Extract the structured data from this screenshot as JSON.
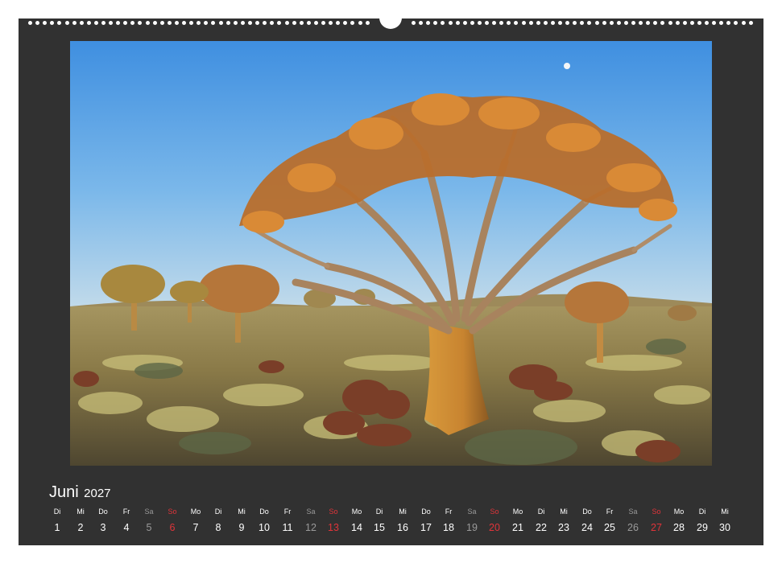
{
  "calendar": {
    "month": "Juni",
    "year": "2027",
    "photo_subject": "quiver-tree-landscape",
    "colors": {
      "frame": "#313131",
      "text": "#ffffff",
      "saturday": "#9a9a9a",
      "sunday": "#e0343a",
      "sky_top": "#3f8fe0",
      "sky_bottom": "#bcd9ee",
      "ground": "#8a7a48"
    },
    "days": [
      {
        "wd": "Di",
        "num": "1",
        "type": "weekday"
      },
      {
        "wd": "Mi",
        "num": "2",
        "type": "weekday"
      },
      {
        "wd": "Do",
        "num": "3",
        "type": "weekday"
      },
      {
        "wd": "Fr",
        "num": "4",
        "type": "weekday"
      },
      {
        "wd": "Sa",
        "num": "5",
        "type": "sat"
      },
      {
        "wd": "So",
        "num": "6",
        "type": "sun"
      },
      {
        "wd": "Mo",
        "num": "7",
        "type": "weekday"
      },
      {
        "wd": "Di",
        "num": "8",
        "type": "weekday"
      },
      {
        "wd": "Mi",
        "num": "9",
        "type": "weekday"
      },
      {
        "wd": "Do",
        "num": "10",
        "type": "weekday"
      },
      {
        "wd": "Fr",
        "num": "11",
        "type": "weekday"
      },
      {
        "wd": "Sa",
        "num": "12",
        "type": "sat"
      },
      {
        "wd": "So",
        "num": "13",
        "type": "sun"
      },
      {
        "wd": "Mo",
        "num": "14",
        "type": "weekday"
      },
      {
        "wd": "Di",
        "num": "15",
        "type": "weekday"
      },
      {
        "wd": "Mi",
        "num": "16",
        "type": "weekday"
      },
      {
        "wd": "Do",
        "num": "17",
        "type": "weekday"
      },
      {
        "wd": "Fr",
        "num": "18",
        "type": "weekday"
      },
      {
        "wd": "Sa",
        "num": "19",
        "type": "sat"
      },
      {
        "wd": "So",
        "num": "20",
        "type": "sun"
      },
      {
        "wd": "Mo",
        "num": "21",
        "type": "weekday"
      },
      {
        "wd": "Di",
        "num": "22",
        "type": "weekday"
      },
      {
        "wd": "Mi",
        "num": "23",
        "type": "weekday"
      },
      {
        "wd": "Do",
        "num": "24",
        "type": "weekday"
      },
      {
        "wd": "Fr",
        "num": "25",
        "type": "weekday"
      },
      {
        "wd": "Sa",
        "num": "26",
        "type": "sat"
      },
      {
        "wd": "So",
        "num": "27",
        "type": "sun"
      },
      {
        "wd": "Mo",
        "num": "28",
        "type": "weekday"
      },
      {
        "wd": "Di",
        "num": "29",
        "type": "weekday"
      },
      {
        "wd": "Mi",
        "num": "30",
        "type": "weekday"
      }
    ]
  }
}
